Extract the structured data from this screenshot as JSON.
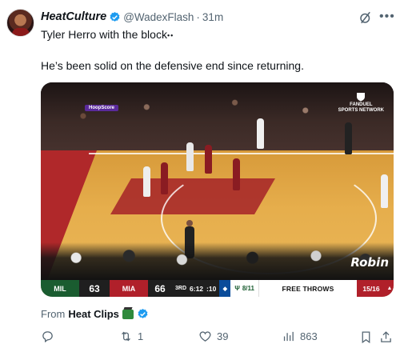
{
  "tweet": {
    "display_name": "HeatCulture",
    "handle": "@WadexFlash",
    "separator": "·",
    "time": "31m",
    "line1_text": "Tyler Herro with the block",
    "line1_emoji": "••",
    "line2_text": "He’s been solid on the defensive end since returning."
  },
  "media": {
    "sponsor_line1": "FANDUEL",
    "sponsor_line2": "SPORTS NETWORK",
    "court_ad": "Robin",
    "led_text": "HoopScore"
  },
  "scoreboard": {
    "team1_abbr": "MIL",
    "team1_score": "63",
    "team2_abbr": "MIA",
    "team2_score": "66",
    "quarter": "3RD",
    "clock": "6:12",
    "shot_clock": ":10",
    "bonus_label": "8/11",
    "status": "FREE THROWS",
    "ft_stat": "15/16"
  },
  "attribution": {
    "prefix": "From",
    "source": "Heat Clips"
  },
  "actions": {
    "reply_count": "",
    "retweet_count": "1",
    "like_count": "39",
    "views_count": "863"
  },
  "colors": {
    "verified": "#1d9bf0",
    "muted": "#536471",
    "heat_red": "#b0202a",
    "bucks_green": "#1a5c30"
  },
  "icons": [
    "verified-icon",
    "grok-icon",
    "more-icon",
    "reply-icon",
    "retweet-icon",
    "like-icon",
    "views-icon",
    "bookmark-icon",
    "share-icon"
  ]
}
